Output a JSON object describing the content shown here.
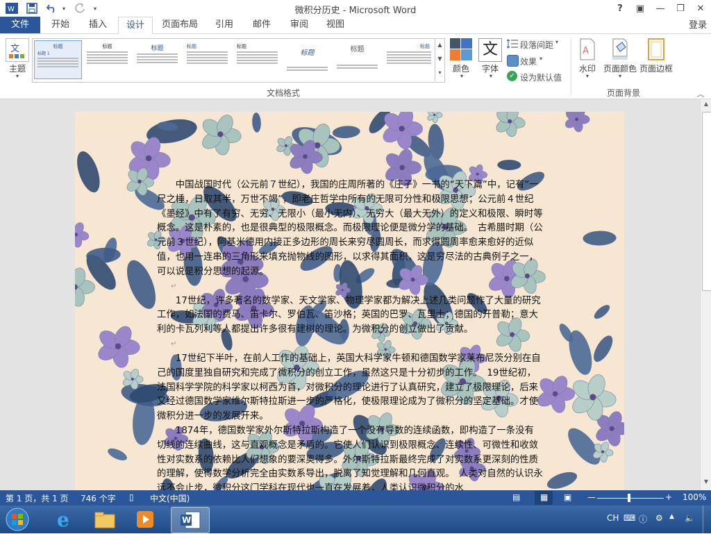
{
  "window": {
    "title": "微积分历史 - Microsoft Word"
  },
  "qat": {
    "undo_arrow": "▾",
    "more": "▾"
  },
  "window_controls": {
    "help": "?",
    "ribbon_options": "▣",
    "minimize": "—",
    "restore": "❐",
    "close": "✕"
  },
  "tabs": [
    "文件",
    "开始",
    "插入",
    "设计",
    "页面布局",
    "引用",
    "邮件",
    "审阅",
    "视图"
  ],
  "active_tab": "设计",
  "login": "登录",
  "ribbon": {
    "theme": "主题",
    "gallery_heading": "标题",
    "gallery_subheading": "标题 1",
    "gallery_group": "文档格式",
    "colors": "颜色",
    "fonts": "字体",
    "fonts_glyph": "文",
    "paragraph_spacing": "段落间距",
    "effects": "效果",
    "set_default": "设为默认值",
    "watermark": "水印",
    "page_color": "页面颜色",
    "page_borders": "页面边框",
    "page_bg_group": "页面背景"
  },
  "document": {
    "paragraphs": [
      "中国战国时代（公元前７世纪），我国的庄周所著的《庄子》一书的“天下篇”中，记有“一尺之棰，日取其半，万世不竭”，即老庄哲学中所有的无限可分性和极限思想；公元前４世纪《墨经》中有了有穷、无穷、无限小（最小无内）、无穷大（最大无外）的定义和极限、瞬时等概念。这是朴素的，也是很典型的极限概念。而极限理论便是微分学的基础。　古希腊时期（公元前３世纪），阿基米德用内接正多边形的周长来穷尽圆周长，而求得圆周率愈来愈好的近似值，也用一连串的三角形来填充抛物线的图形，以求得其面积，这是穷尽法的古典例子之一，可以说是积分思想的起源。",
      "17世纪，许多著名的数学家、天文学家、物理学家都为解决上述几类问题作了大量的研究工作，如法国的费马、笛卡尔、罗伯瓦、笛沙格；英国的巴罗、瓦里士；德国的开普勒；意大利的卡瓦列利等人都提出许多很有建树的理论。为微积分的创立做出了贡献。",
      "17世纪下半叶，在前人工作的基础上，英国大科学家牛顿和德国数学家莱布尼茨分别在自己的国度里独自研究和完成了微积分的创立工作，虽然这只是十分初步的工作。　19世纪初，法国科学学院的科学家以柯西为首，对微积分的理论进行了认真研究，建立了极限理论，后来又经过德国数学家维尔斯特拉斯进一步的严格化，使极限理论成为了微积分的坚定基础。才使微积分进一步的发展开来。",
      "1874年，德国数学家外尔斯特拉斯构造了一个没有导数的连续函数，即构造了一条没有切线的连续曲线，这与直观概念是矛盾的。它使人们认识到极限概念、连续性、可微性和收敛性对实数系的依赖比人们想象的要深奥得多。外尔斯特拉斯最终完成了对实数系更深刻的性质的理解，使得数学分析完全由实数系导出，脱离了知觉理解和几何直观。　人类对自然的认识永远不会止步，微积分这门学科在现代也一直在发展着，人类认识微积分的水"
    ],
    "para_mark": "↵"
  },
  "status": {
    "page": "第 1 页，共 1 页",
    "words": "746 个字",
    "language": "中文(中国)",
    "zoom": "100%"
  },
  "tray": {
    "ime": "CH"
  },
  "colors": {
    "accent": "#2b579a",
    "page_bg": "#f7e7d2"
  }
}
